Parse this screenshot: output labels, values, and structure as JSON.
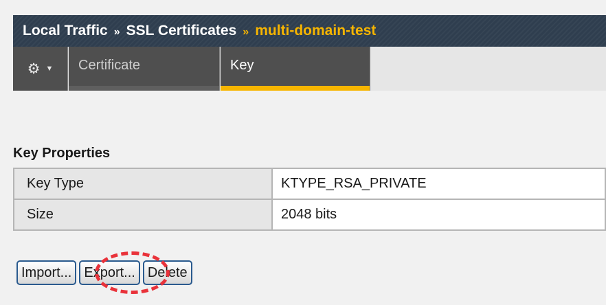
{
  "breadcrumb": {
    "section": "Local Traffic",
    "separator": "»",
    "subsection": "SSL Certificates",
    "current": "multi-domain-test"
  },
  "tabs": {
    "gear_icon": "⚙",
    "caret_icon": "▼",
    "items": [
      {
        "label": "Certificate",
        "active": false
      },
      {
        "label": "Key",
        "active": true
      }
    ],
    "active_color": "#f7b500"
  },
  "key_properties": {
    "title": "Key Properties",
    "rows": [
      {
        "label": "Key Type",
        "value": "KTYPE_RSA_PRIVATE"
      },
      {
        "label": "Size",
        "value": "2048 bits"
      }
    ]
  },
  "actions": {
    "import_label": "Import...",
    "export_label": "Export...",
    "delete_label": "Delete",
    "highlighted": "Export...",
    "highlight_color": "#e9323a"
  }
}
